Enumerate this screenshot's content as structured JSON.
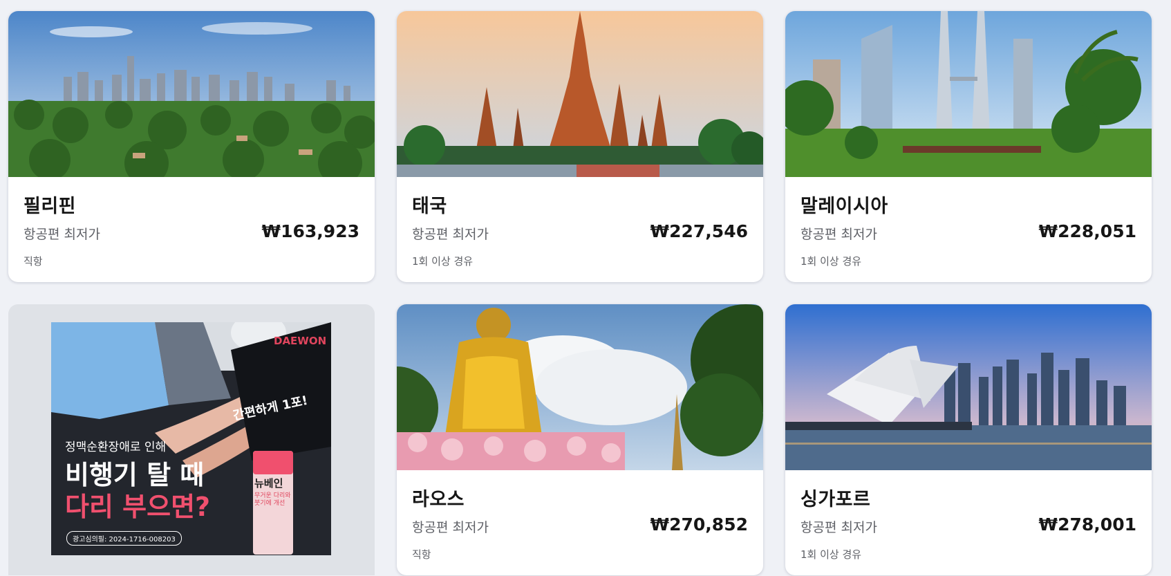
{
  "cards": [
    {
      "destination": "필리핀",
      "price_label": "항공편 최저가",
      "price": "₩163,923",
      "stops": "직항"
    },
    {
      "destination": "태국",
      "price_label": "항공편 최저가",
      "price": "₩227,546",
      "stops": "1회 이상 경유"
    },
    {
      "destination": "말레이시아",
      "price_label": "항공편 최저가",
      "price": "₩228,051",
      "stops": "1회 이상 경유"
    },
    {
      "destination": "라오스",
      "price_label": "항공편 최저가",
      "price": "₩270,852",
      "stops": "직항"
    },
    {
      "destination": "싱가포르",
      "price_label": "항공편 최저가",
      "price": "₩278,001",
      "stops": "1회 이상 경유"
    }
  ],
  "ad": {
    "brand": "DAEWON",
    "tagline": "간편하게 1포!",
    "line1": "정맥순환장애로 인해",
    "line2": "비행기 탈 때",
    "line3": "다리 부으면?",
    "approval": "광고심의필: 2024-1716-008203",
    "product_name": "뉴베인",
    "product_copy": "무거운 다리와 붓기에 개선"
  },
  "colors": {
    "page_bg": "#eff1f6",
    "card_bg": "#ffffff",
    "ad_bg": "#dfe2e7",
    "ad_accent": "#f0506e"
  }
}
